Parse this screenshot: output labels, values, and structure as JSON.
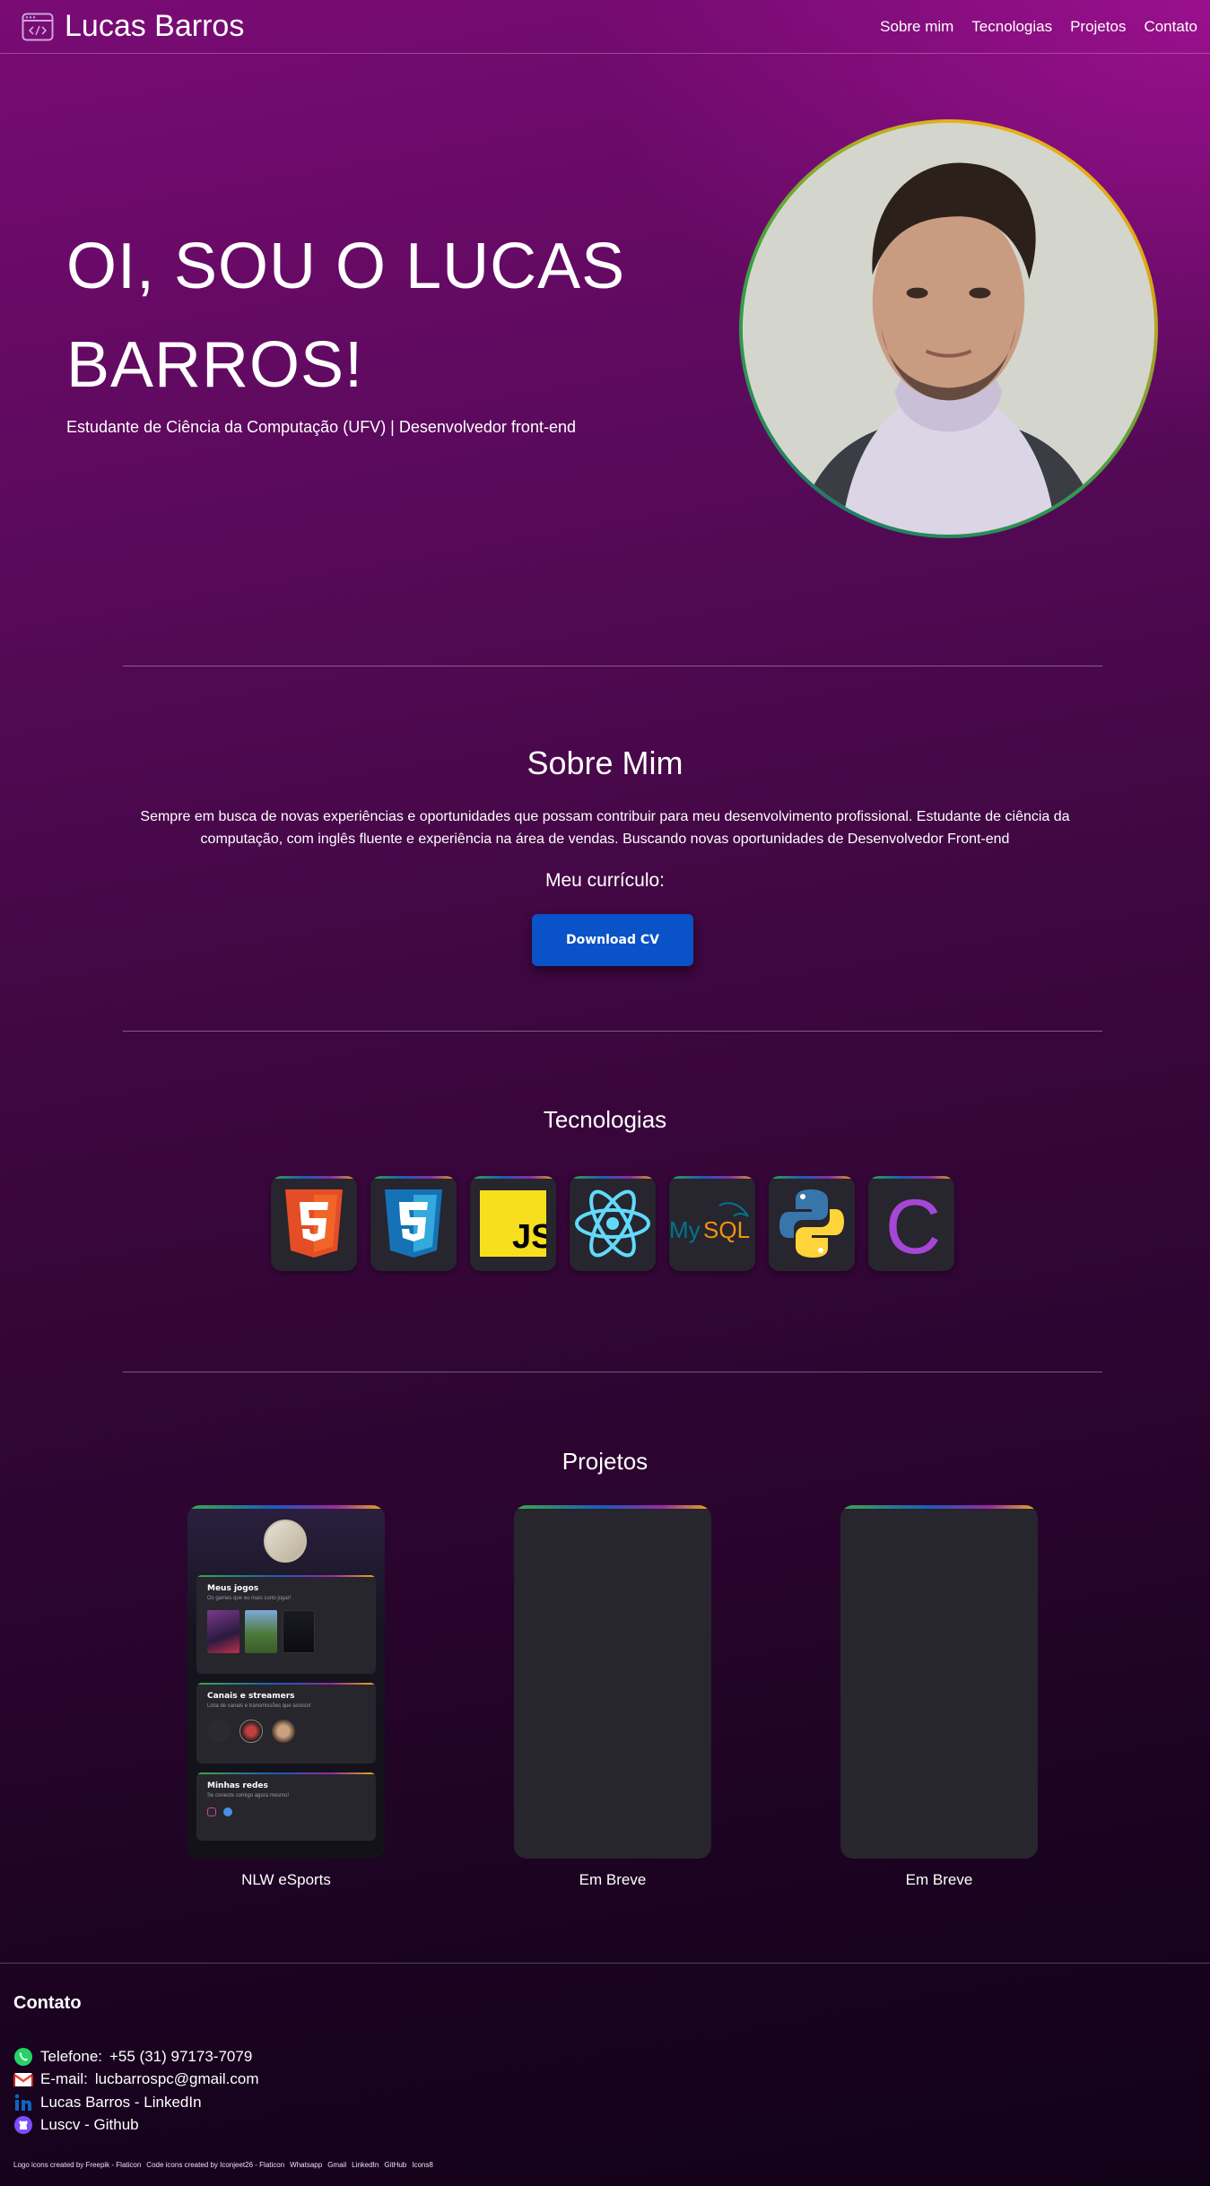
{
  "header": {
    "brand": "Lucas Barros",
    "nav": [
      "Sobre mim",
      "Tecnologias",
      "Projetos",
      "Contato"
    ]
  },
  "hero": {
    "title": "OI, SOU O LUCAS BARROS!",
    "subtitle": "Estudante de Ciência da Computação (UFV) | Desenvolvedor front-end"
  },
  "about": {
    "title": "Sobre Mim",
    "text": "Sempre em busca de novas experiências e oportunidades que possam contribuir para meu desenvolvimento profissional. Estudante de ciência da computação, com inglês fluente e experiência na área de vendas. Buscando novas oportunidades de Desenvolvedor Front-end",
    "cv_label": "Meu currículo:",
    "cv_button": "Download CV"
  },
  "technologies": {
    "title": "Tecnologias",
    "items": [
      "html5-icon",
      "css3-icon",
      "javascript-icon",
      "react-icon",
      "mysql-icon",
      "python-icon",
      "c-language-icon"
    ],
    "js_text": "JS",
    "mysql_my": "My",
    "mysql_sql": "SQL",
    "c_text": "C"
  },
  "projects": {
    "title": "Projetos",
    "items": [
      {
        "label": "NLW eSports",
        "games_title": "Meus jogos",
        "games_sub": "Os games que eu mais curto jogar!",
        "streamers_title": "Canais e streamers",
        "streamers_sub": "Lista de canais e transmissões que assisto!",
        "socials_title": "Minhas redes",
        "socials_sub": "Se conecte comigo agora mesmo!"
      },
      {
        "label": "Em Breve"
      },
      {
        "label": "Em Breve"
      }
    ]
  },
  "contact": {
    "title": "Contato",
    "phone_label": "Telefone:",
    "phone": "+55 (31) 97173-7079",
    "email_label": "E-mail:",
    "email": "lucbarrospc@gmail.com",
    "linkedin": "Lucas Barros - LinkedIn",
    "github": "Luscv - Github"
  },
  "credits": [
    "Logo icons created by Freepik - Flaticon",
    "Code icons created by Iconjeet26 - Flaticon",
    "Whatsapp",
    "Gmail",
    "LinkedIn",
    "GitHub",
    "Icons8"
  ],
  "colors": {
    "accent_button": "#0a52c7",
    "card_bg": "#27252e",
    "gradient_top": "#7a0b75",
    "gradient_bottom": "#120218"
  }
}
